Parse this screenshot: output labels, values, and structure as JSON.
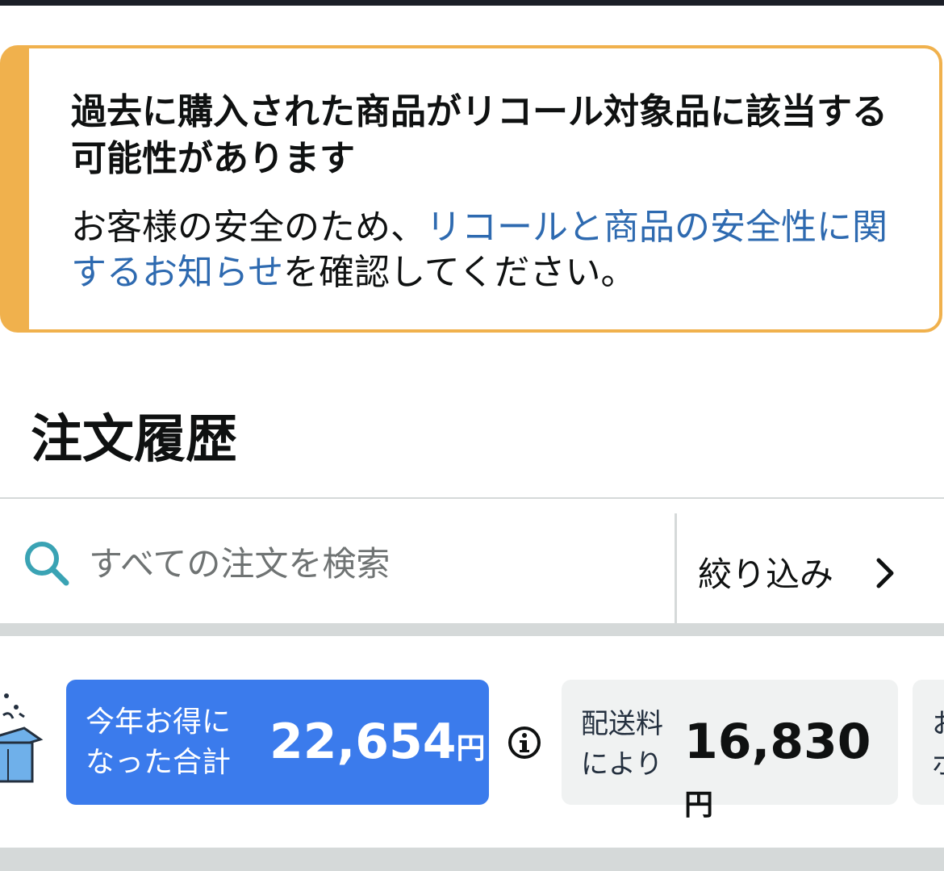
{
  "recall_alert": {
    "title": "過去に購入された商品がリコール対象品に該当する可能性があります",
    "body_before": "お客様の安全のため、",
    "link_text": "リコールと商品の安全性に関するお知らせ",
    "body_after": "を確認してください。"
  },
  "page_title": "注文履歴",
  "search": {
    "placeholder": "すべての注文を検索",
    "filter_label": "絞り込み"
  },
  "savings": {
    "total_card": {
      "label_line1": "今年お得に",
      "label_line2": "なった合計",
      "amount": "22,654",
      "unit": "円"
    },
    "shipping_card": {
      "label_line1": "配送料",
      "label_line2": "により",
      "amount": "16,830",
      "unit": "円"
    },
    "partial_card": {
      "label_line1": "お",
      "label_line2": "ポ"
    }
  },
  "colors": {
    "alert_border": "#f0b14d",
    "link": "#2e6ab0",
    "total_card_bg": "#3b7bec",
    "search_icon": "#3aa3b4",
    "card_bg": "#f0f2f2"
  },
  "icons": [
    "search-icon",
    "chevron-right-icon",
    "box-icon",
    "info-icon"
  ]
}
